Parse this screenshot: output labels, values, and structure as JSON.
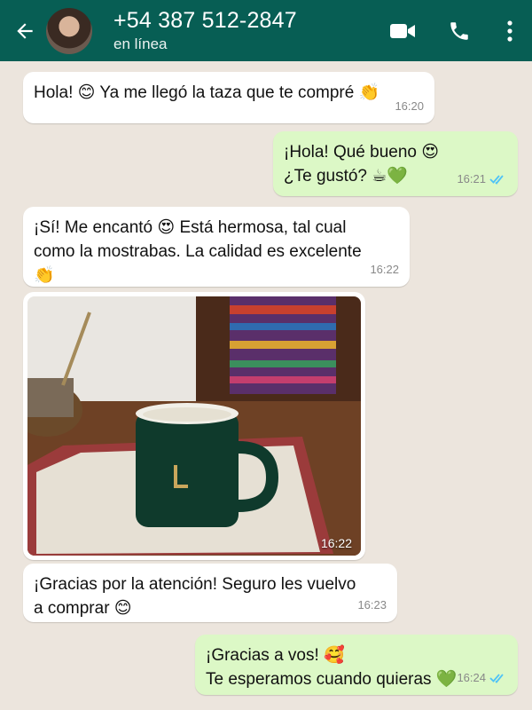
{
  "header": {
    "name": "+54 387 512-2847",
    "status": "en línea",
    "icons": [
      "back-arrow-icon",
      "video-call-icon",
      "phone-icon",
      "more-options-icon"
    ]
  },
  "messages": [
    {
      "dir": "in",
      "text": "Hola! 😊 Ya me llegó la taza que te compré 👏",
      "time": "16:20"
    },
    {
      "dir": "out",
      "line1": "¡Hola! Qué bueno 😍",
      "line2": "¿Te gustó? ☕💚",
      "time": "16:21",
      "ticks": "read"
    },
    {
      "dir": "in",
      "line1": "¡Sí! Me encantó 😍 Está hermosa, tal cual",
      "line2": "como la mostrabas. La calidad es excelente",
      "line3": "👏",
      "time": "16:22"
    },
    {
      "dir": "in",
      "type": "image",
      "description": "green mug on lace doily with mate",
      "time": "16:22"
    },
    {
      "dir": "in",
      "line1": "¡Gracias por la atención! Seguro les vuelvo",
      "line2": "a comprar 😊",
      "time": "16:23"
    },
    {
      "dir": "out",
      "line1": "¡Gracias a vos! 🥰",
      "line2": "Te esperamos cuando quieras 💚",
      "time": "16:24",
      "ticks": "read"
    }
  ],
  "colors": {
    "header": "#075e54",
    "incoming": "#ffffff",
    "outgoing": "#dcf8c6",
    "read_ticks": "#4fc3f7",
    "background": "#ece5dd"
  }
}
